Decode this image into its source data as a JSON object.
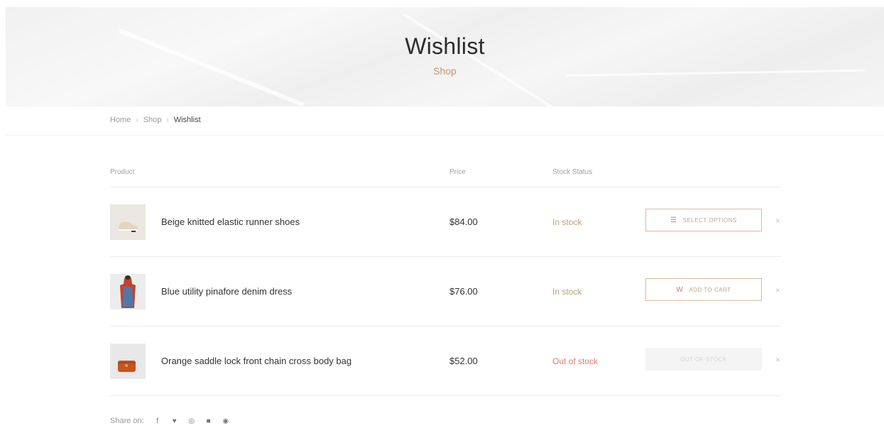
{
  "hero": {
    "title": "Wishlist",
    "subtitle": "Shop"
  },
  "breadcrumb": [
    "Home",
    "Shop",
    "Wishlist"
  ],
  "table": {
    "headers": {
      "product": "Product",
      "price": "Price",
      "stock": "Stock Status"
    },
    "rows": [
      {
        "name": "Beige knitted elastic runner shoes",
        "price": "$84.00",
        "stock": "In stock",
        "stock_color": "#b6a27a",
        "button": "Select options",
        "button_icon": "list-icon",
        "disabled": false,
        "thumb": "shoe"
      },
      {
        "name": "Blue utility pinafore denim dress",
        "price": "$76.00",
        "stock": "In stock",
        "stock_color": "#b6a27a",
        "button": "Add to cart",
        "button_icon": "bag-icon",
        "disabled": false,
        "thumb": "dress"
      },
      {
        "name": "Orange saddle lock front chain cross body bag",
        "price": "$52.00",
        "stock": "Out of stock",
        "stock_color": "#e07a6e",
        "button": "Out of stock",
        "button_icon": "",
        "disabled": true,
        "thumb": "bag"
      }
    ]
  },
  "share": {
    "label": "Share on:",
    "icons": [
      "facebook-icon",
      "twitter-icon",
      "pinterest-icon",
      "email-icon",
      "whatsapp-icon"
    ]
  },
  "colors": {
    "accent": "#c2966b",
    "border": "#d9b9a0"
  }
}
